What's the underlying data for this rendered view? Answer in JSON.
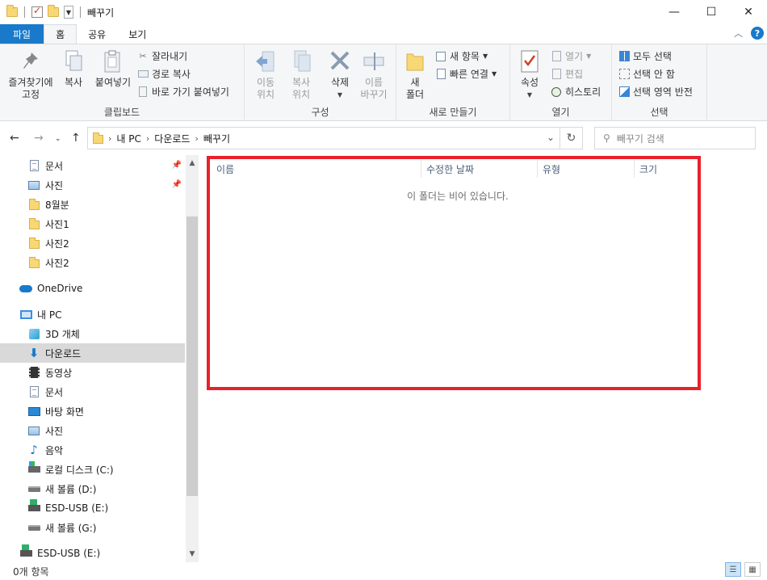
{
  "window": {
    "title": "빼꾸기",
    "controls": {
      "minimize": "—",
      "maximize": "☐",
      "close": "✕"
    }
  },
  "tabs": [
    {
      "label": "파일"
    },
    {
      "label": "홈"
    },
    {
      "label": "공유"
    },
    {
      "label": "보기"
    }
  ],
  "ribbon": {
    "clipboard": {
      "label": "클립보드",
      "pin_label": "즐겨찾기에\n고정",
      "copy_label": "복사",
      "paste_label": "붙여넣기",
      "cut_label": "잘라내기",
      "copy_path_label": "경로 복사",
      "paste_shortcut_label": "바로 가기 붙여넣기"
    },
    "organize": {
      "label": "구성",
      "move_label": "이동\n위치",
      "copyto_label": "복사\n위치",
      "delete_label": "삭제",
      "rename_label": "이름\n바꾸기"
    },
    "new": {
      "label": "새로 만들기",
      "new_folder_label": "새\n폴더",
      "new_item_label": "새 항목",
      "easy_access_label": "빠른 연결"
    },
    "open": {
      "label": "열기",
      "properties_label": "속성",
      "open_label": "열기",
      "edit_label": "편집",
      "history_label": "히스토리"
    },
    "select": {
      "label": "선택",
      "select_all_label": "모두 선택",
      "select_none_label": "선택 안 함",
      "invert_label": "선택 영역 반전"
    }
  },
  "address": {
    "path": [
      "내 PC",
      "다운로드",
      "빼꾸기"
    ],
    "search_placeholder": "빼꾸기 검색"
  },
  "nav": {
    "items": [
      {
        "label": "문서",
        "icon": "document-icon",
        "pinned": true
      },
      {
        "label": "사진",
        "icon": "picture-icon",
        "pinned": true
      },
      {
        "label": "8월분",
        "icon": "folder-icon"
      },
      {
        "label": "사진1",
        "icon": "folder-icon"
      },
      {
        "label": "사진2",
        "icon": "folder-icon"
      },
      {
        "label": "사진2",
        "icon": "folder-icon"
      },
      {
        "label": "OneDrive",
        "icon": "cloud-icon"
      },
      {
        "label": "내 PC",
        "icon": "pc-icon"
      },
      {
        "label": "3D 개체",
        "icon": "3d-objects-icon"
      },
      {
        "label": "다운로드",
        "icon": "download-icon",
        "selected": true
      },
      {
        "label": "동영상",
        "icon": "video-icon"
      },
      {
        "label": "문서",
        "icon": "document-icon"
      },
      {
        "label": "바탕 화면",
        "icon": "desktop-icon"
      },
      {
        "label": "사진",
        "icon": "picture-icon"
      },
      {
        "label": "음악",
        "icon": "music-icon"
      },
      {
        "label": "로컬 디스크 (C:)",
        "icon": "windows-drive-icon"
      },
      {
        "label": "새 볼륨 (D:)",
        "icon": "drive-icon"
      },
      {
        "label": "ESD-USB (E:)",
        "icon": "usb-drive-icon"
      },
      {
        "label": "새 볼륨 (G:)",
        "icon": "drive-icon"
      },
      {
        "label": "ESD-USB (E:)",
        "icon": "usb-drive-icon"
      }
    ]
  },
  "content": {
    "columns": [
      "이름",
      "수정한 날짜",
      "유형",
      "크기"
    ],
    "empty_message": "이 폴더는 비어 있습니다."
  },
  "status": {
    "item_count": "0개 항목"
  },
  "colors": {
    "accent": "#1979ca",
    "highlight_border": "#e8202a",
    "selected_bg": "#d9d9d9"
  }
}
